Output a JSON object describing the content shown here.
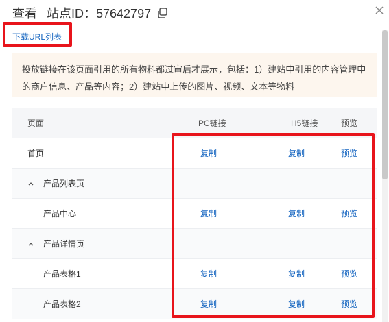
{
  "header": {
    "title": "查看",
    "site_id_label": "站点ID：57642797"
  },
  "download_link": "下载URL列表",
  "notice": "投放链接在该页面引用的所有物料都过审后才展示，包括：1）建站中引用的内容管理中的商户信息、产品等内容；2）建站中上传的图片、视频、文本等物料",
  "table": {
    "headers": {
      "page": "页面",
      "pc": "PC链接",
      "h5": "H5链接",
      "preview": "预览"
    },
    "rows": [
      {
        "label": "首页",
        "pc": "复制",
        "h5": "复制",
        "preview": "预览"
      },
      {
        "label": "产品列表页"
      },
      {
        "label": "产品中心",
        "pc": "复制",
        "h5": "复制",
        "preview": "预览"
      },
      {
        "label": "产品详情页"
      },
      {
        "label": "产品表格1",
        "pc": "复制",
        "h5": "复制",
        "preview": "预览"
      },
      {
        "label": "产品表格2",
        "pc": "复制",
        "h5": "复制",
        "preview": "预览"
      }
    ]
  },
  "colors": {
    "link": "#1565c0",
    "highlight": "#e8141b",
    "notice_bg": "#fdf6ee"
  }
}
